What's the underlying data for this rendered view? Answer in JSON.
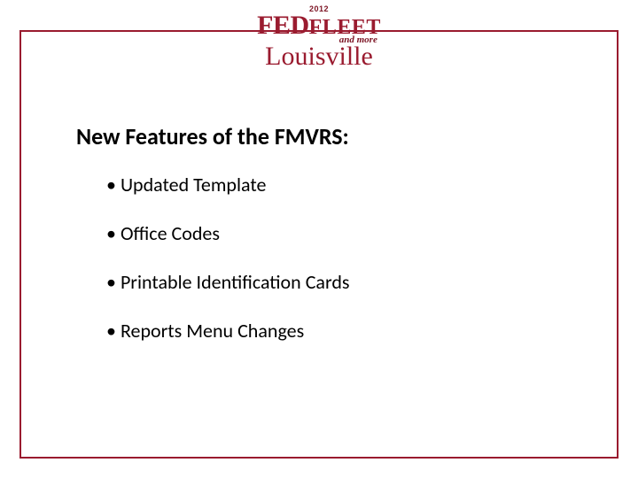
{
  "logo": {
    "year": "2012",
    "brand_fed": "FED",
    "brand_fleet": "FLEET",
    "andmore": "and more",
    "city": "Louisville"
  },
  "heading": "New Features of the FMVRS:",
  "bullets": [
    "Updated Template",
    "Office Codes",
    "Printable Identification Cards",
    "Reports Menu Changes"
  ]
}
